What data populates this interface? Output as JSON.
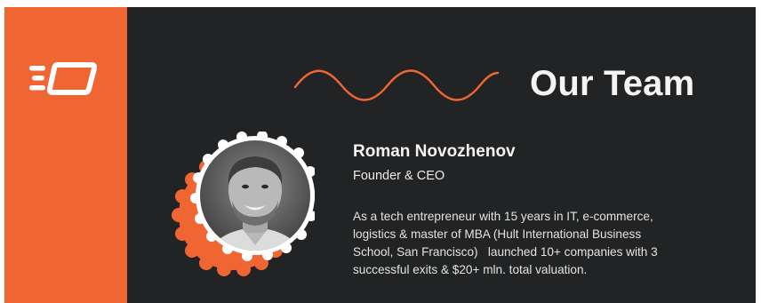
{
  "brand": {
    "logo_icon": "speed-rectangle-logo-icon",
    "accent_color": "#ef6633",
    "background_color": "#222324",
    "text_color": "#f4f4f2"
  },
  "heading": {
    "title": "Our Team",
    "decoration_icon": "wave-line-icon"
  },
  "member": {
    "name": "Roman Novozhenov",
    "role": "Founder & CEO",
    "photo_icon": "portrait-photo",
    "bio_lines": [
      "As a tech entrepreneur with 15 years in IT, e-commerce,",
      "logistics & master of MBA (Hult International Business",
      "School, San Francisco)   launched 10+ companies with 3",
      "successful exits & $20+ mln. total valuation."
    ]
  }
}
